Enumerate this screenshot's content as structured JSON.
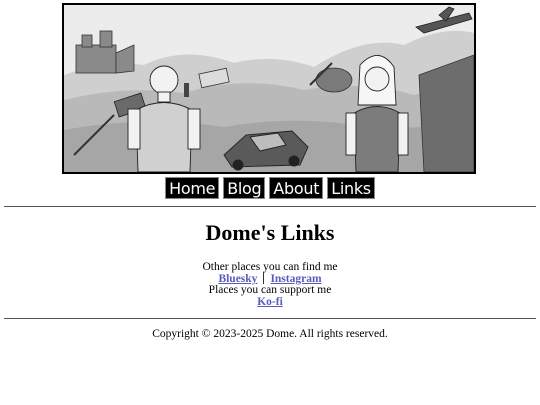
{
  "nav": {
    "home": "Home",
    "blog": "Blog",
    "about": "About",
    "links": "Links"
  },
  "page": {
    "title": "Dome's Links",
    "find_me_text": "Other places you can find me",
    "support_text": "Places you can support me"
  },
  "links": {
    "bluesky": "Bluesky",
    "instagram": "Instagram",
    "kofi": "Ko-fi"
  },
  "footer": {
    "copyright": "Copyright © 2023-2025 Dome. All rights reserved."
  },
  "colors": {
    "link": "#5a5ab8",
    "nav_bg": "#000000",
    "nav_text": "#ffffff"
  }
}
